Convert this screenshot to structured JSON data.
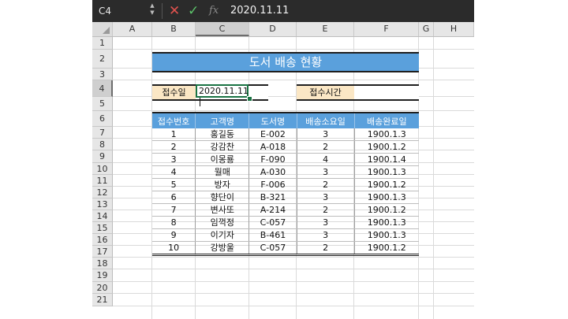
{
  "formula_bar": {
    "name_box": "C4",
    "content": "2020.11.11",
    "cancel_symbol": "✕",
    "enter_symbol": "✓",
    "fx_symbol": "fx"
  },
  "columns": [
    "A",
    "B",
    "C",
    "D",
    "E",
    "F",
    "G",
    "H"
  ],
  "active_column": "C",
  "rows": [
    "1",
    "2",
    "3",
    "4",
    "5",
    "6",
    "7",
    "8",
    "9",
    "10",
    "11",
    "12",
    "13",
    "14",
    "15",
    "16",
    "17",
    "18",
    "19",
    "20",
    "21"
  ],
  "active_row": "4",
  "sheet": {
    "title": "도서 배송 현황",
    "received_date_label": "접수일",
    "received_date_value": "2020.11.11",
    "received_time_label": "접수시간",
    "received_time_value": "",
    "table": {
      "headers": [
        "접수번호",
        "고객명",
        "도서명",
        "배송소요일",
        "배송완료일"
      ],
      "rows": [
        [
          "1",
          "홍길동",
          "E-002",
          "3",
          "1900.1.3"
        ],
        [
          "2",
          "강감찬",
          "A-018",
          "2",
          "1900.1.2"
        ],
        [
          "3",
          "이몽룡",
          "F-090",
          "4",
          "1900.1.4"
        ],
        [
          "4",
          "월매",
          "A-030",
          "3",
          "1900.1.3"
        ],
        [
          "5",
          "방자",
          "F-006",
          "2",
          "1900.1.2"
        ],
        [
          "6",
          "향단이",
          "B-321",
          "3",
          "1900.1.3"
        ],
        [
          "7",
          "변사또",
          "A-214",
          "2",
          "1900.1.2"
        ],
        [
          "8",
          "임꺽정",
          "C-057",
          "3",
          "1900.1.3"
        ],
        [
          "9",
          "이기자",
          "B-461",
          "3",
          "1900.1.3"
        ],
        [
          "10",
          "강방울",
          "C-057",
          "2",
          "1900.1.2"
        ]
      ]
    }
  },
  "colors": {
    "header_blue": "#5aa0dc",
    "label_fill": "#fbe7c5",
    "active_cell_border": "#1a7343",
    "formula_bar_bg": "#2b2b2b"
  }
}
